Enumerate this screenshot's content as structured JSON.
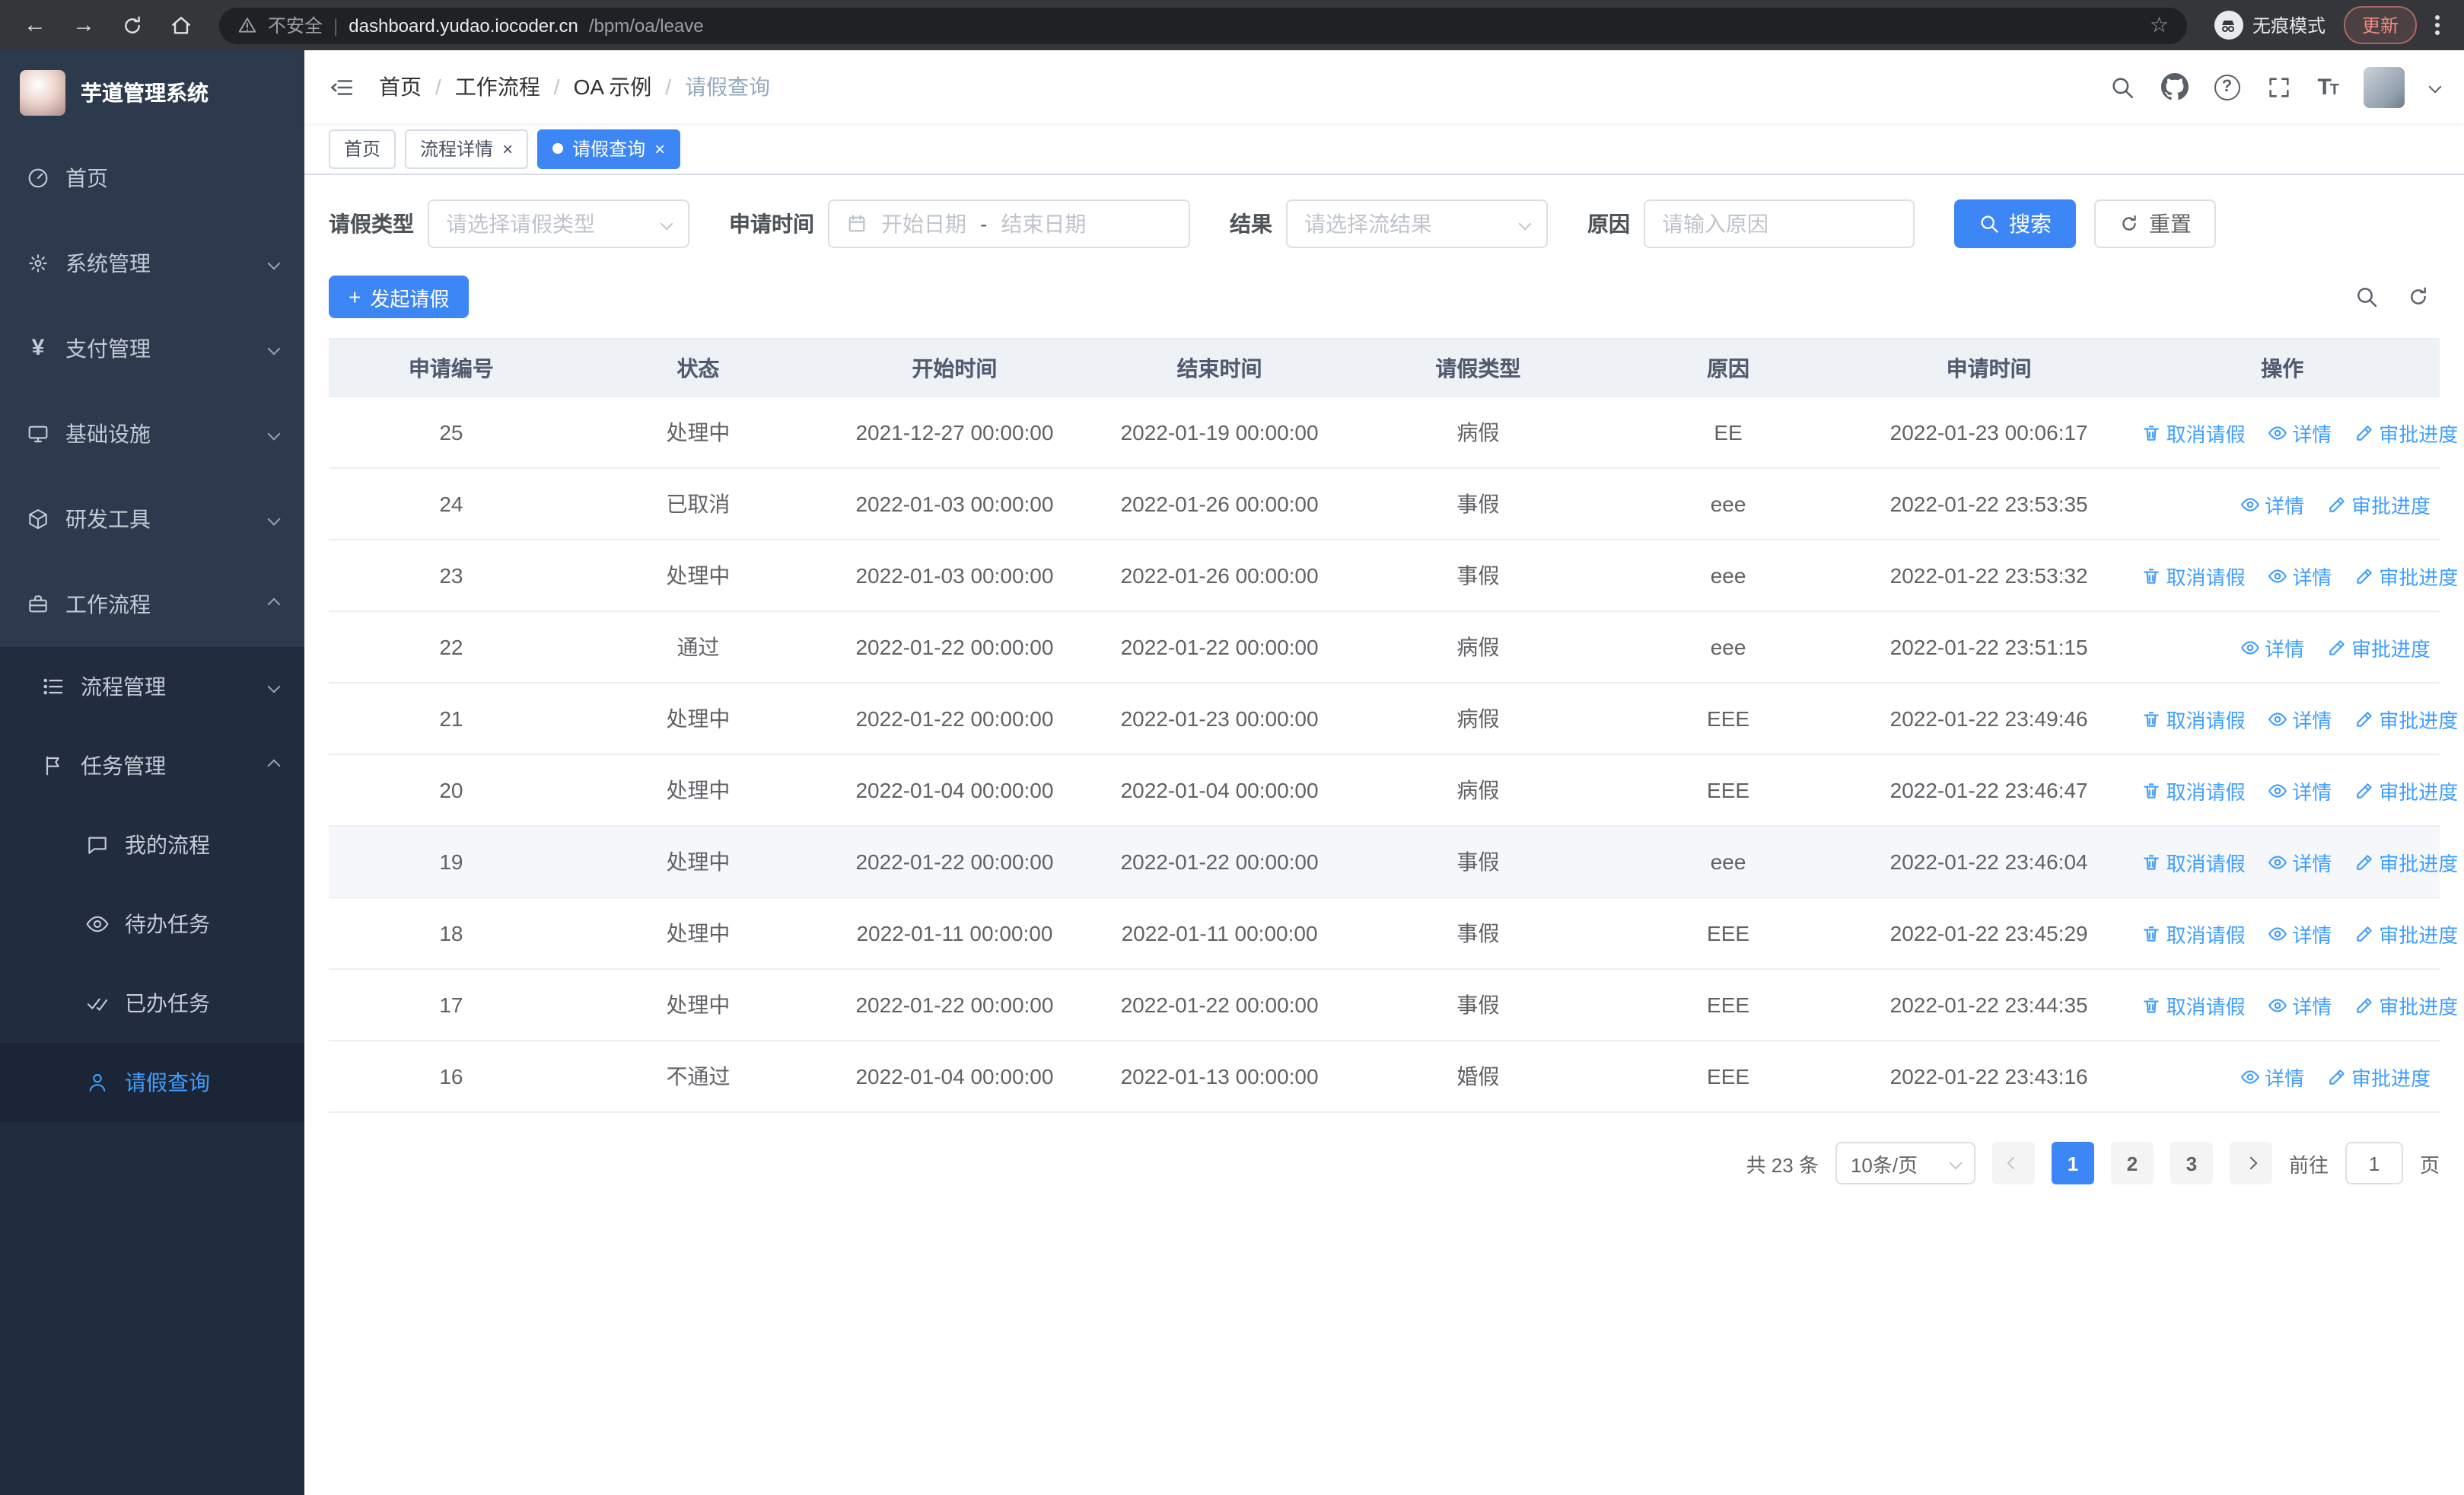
{
  "colors": {
    "primary": "#3d86f5",
    "link": "#409eff",
    "sidebar_bg": "#2d3a4d",
    "submenu_bg": "#212c3e"
  },
  "browser": {
    "security_label": "不安全",
    "url_host": "dashboard.yudao.iocoder.cn",
    "url_path": "/bpm/oa/leave",
    "incognito_label": "无痕模式",
    "update_label": "更新"
  },
  "sidebar": {
    "logo_title": "芋道管理系统",
    "menu": [
      {
        "label": "首页"
      },
      {
        "label": "系统管理"
      },
      {
        "label": "支付管理"
      },
      {
        "label": "基础设施"
      },
      {
        "label": "研发工具"
      },
      {
        "label": "工作流程"
      }
    ],
    "submenu": [
      {
        "label": "流程管理"
      },
      {
        "label": "任务管理"
      }
    ],
    "task_children": [
      {
        "label": "我的流程"
      },
      {
        "label": "待办任务"
      },
      {
        "label": "已办任务"
      },
      {
        "label": "请假查询"
      }
    ]
  },
  "header": {
    "breadcrumb": [
      "首页",
      "工作流程",
      "OA 示例",
      "请假查询"
    ]
  },
  "tabs": [
    {
      "label": "首页"
    },
    {
      "label": "流程详情"
    },
    {
      "label": "请假查询"
    }
  ],
  "filters": {
    "leave_type_label": "请假类型",
    "leave_type_placeholder": "请选择请假类型",
    "apply_time_label": "申请时间",
    "date_start_placeholder": "开始日期",
    "date_separator": "-",
    "date_end_placeholder": "结束日期",
    "result_label": "结果",
    "result_placeholder": "请选择流结果",
    "reason_label": "原因",
    "reason_placeholder": "请输入原因",
    "search_button": "搜索",
    "reset_button": "重置"
  },
  "toolbar": {
    "create_button": "发起请假"
  },
  "table": {
    "columns": [
      "申请编号",
      "状态",
      "开始时间",
      "结束时间",
      "请假类型",
      "原因",
      "申请时间",
      "操作"
    ],
    "op_labels": {
      "cancel": "取消请假",
      "detail": "详情",
      "progress": "审批进度"
    },
    "rows": [
      {
        "id": "25",
        "status": "处理中",
        "start": "2021-12-27 00:00:00",
        "end": "2022-01-19 00:00:00",
        "type": "病假",
        "reason": "EE",
        "applied": "2022-01-23 00:06:17"
      },
      {
        "id": "24",
        "status": "已取消",
        "start": "2022-01-03 00:00:00",
        "end": "2022-01-26 00:00:00",
        "type": "事假",
        "reason": "eee",
        "applied": "2022-01-22 23:53:35"
      },
      {
        "id": "23",
        "status": "处理中",
        "start": "2022-01-03 00:00:00",
        "end": "2022-01-26 00:00:00",
        "type": "事假",
        "reason": "eee",
        "applied": "2022-01-22 23:53:32"
      },
      {
        "id": "22",
        "status": "通过",
        "start": "2022-01-22 00:00:00",
        "end": "2022-01-22 00:00:00",
        "type": "病假",
        "reason": "eee",
        "applied": "2022-01-22 23:51:15"
      },
      {
        "id": "21",
        "status": "处理中",
        "start": "2022-01-22 00:00:00",
        "end": "2022-01-23 00:00:00",
        "type": "病假",
        "reason": "EEE",
        "applied": "2022-01-22 23:49:46"
      },
      {
        "id": "20",
        "status": "处理中",
        "start": "2022-01-04 00:00:00",
        "end": "2022-01-04 00:00:00",
        "type": "病假",
        "reason": "EEE",
        "applied": "2022-01-22 23:46:47"
      },
      {
        "id": "19",
        "status": "处理中",
        "start": "2022-01-22 00:00:00",
        "end": "2022-01-22 00:00:00",
        "type": "事假",
        "reason": "eee",
        "applied": "2022-01-22 23:46:04"
      },
      {
        "id": "18",
        "status": "处理中",
        "start": "2022-01-11 00:00:00",
        "end": "2022-01-11 00:00:00",
        "type": "事假",
        "reason": "EEE",
        "applied": "2022-01-22 23:45:29"
      },
      {
        "id": "17",
        "status": "处理中",
        "start": "2022-01-22 00:00:00",
        "end": "2022-01-22 00:00:00",
        "type": "事假",
        "reason": "EEE",
        "applied": "2022-01-22 23:44:35"
      },
      {
        "id": "16",
        "status": "不通过",
        "start": "2022-01-04 00:00:00",
        "end": "2022-01-13 00:00:00",
        "type": "婚假",
        "reason": "EEE",
        "applied": "2022-01-22 23:43:16"
      }
    ]
  },
  "pagination": {
    "total": "共 23 条",
    "page_size": "10条/页",
    "pages": [
      "1",
      "2",
      "3"
    ],
    "goto_label": "前往",
    "goto_value": "1",
    "page_label": "页"
  }
}
